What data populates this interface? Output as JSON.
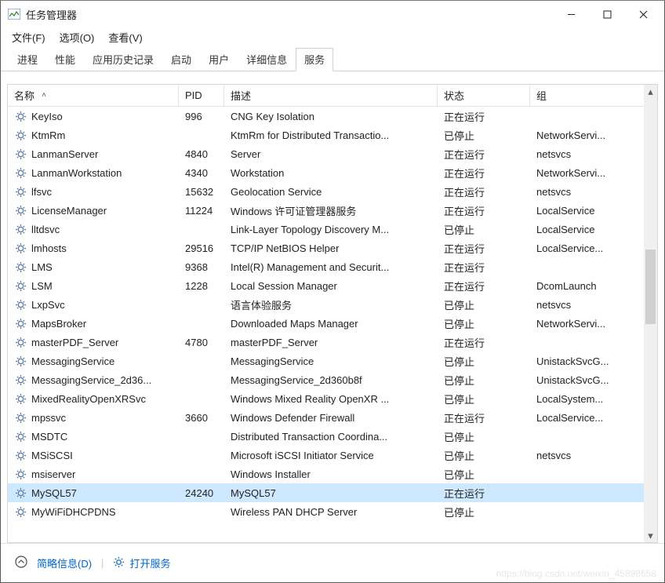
{
  "window": {
    "title": "任务管理器"
  },
  "menubar": [
    {
      "label": "文件(F)"
    },
    {
      "label": "选项(O)"
    },
    {
      "label": "查看(V)"
    }
  ],
  "tabs": [
    {
      "label": "进程",
      "active": false
    },
    {
      "label": "性能",
      "active": false
    },
    {
      "label": "应用历史记录",
      "active": false
    },
    {
      "label": "启动",
      "active": false
    },
    {
      "label": "用户",
      "active": false
    },
    {
      "label": "详细信息",
      "active": false
    },
    {
      "label": "服务",
      "active": true
    }
  ],
  "columns": {
    "name": "名称",
    "pid": "PID",
    "desc": "描述",
    "status": "状态",
    "group": "组"
  },
  "services": [
    {
      "name": "KeyIso",
      "pid": "996",
      "desc": "CNG Key Isolation",
      "status": "正在运行",
      "group": ""
    },
    {
      "name": "KtmRm",
      "pid": "",
      "desc": "KtmRm for Distributed Transactio...",
      "status": "已停止",
      "group": "NetworkServi..."
    },
    {
      "name": "LanmanServer",
      "pid": "4840",
      "desc": "Server",
      "status": "正在运行",
      "group": "netsvcs"
    },
    {
      "name": "LanmanWorkstation",
      "pid": "4340",
      "desc": "Workstation",
      "status": "正在运行",
      "group": "NetworkServi..."
    },
    {
      "name": "lfsvc",
      "pid": "15632",
      "desc": "Geolocation Service",
      "status": "正在运行",
      "group": "netsvcs"
    },
    {
      "name": "LicenseManager",
      "pid": "11224",
      "desc": "Windows 许可证管理器服务",
      "status": "正在运行",
      "group": "LocalService"
    },
    {
      "name": "lltdsvc",
      "pid": "",
      "desc": "Link-Layer Topology Discovery M...",
      "status": "已停止",
      "group": "LocalService"
    },
    {
      "name": "lmhosts",
      "pid": "29516",
      "desc": "TCP/IP NetBIOS Helper",
      "status": "正在运行",
      "group": "LocalService..."
    },
    {
      "name": "LMS",
      "pid": "9368",
      "desc": "Intel(R) Management and Securit...",
      "status": "正在运行",
      "group": ""
    },
    {
      "name": "LSM",
      "pid": "1228",
      "desc": "Local Session Manager",
      "status": "正在运行",
      "group": "DcomLaunch"
    },
    {
      "name": "LxpSvc",
      "pid": "",
      "desc": "语言体验服务",
      "status": "已停止",
      "group": "netsvcs"
    },
    {
      "name": "MapsBroker",
      "pid": "",
      "desc": "Downloaded Maps Manager",
      "status": "已停止",
      "group": "NetworkServi..."
    },
    {
      "name": "masterPDF_Server",
      "pid": "4780",
      "desc": "masterPDF_Server",
      "status": "正在运行",
      "group": ""
    },
    {
      "name": "MessagingService",
      "pid": "",
      "desc": "MessagingService",
      "status": "已停止",
      "group": "UnistackSvcG..."
    },
    {
      "name": "MessagingService_2d36...",
      "pid": "",
      "desc": "MessagingService_2d360b8f",
      "status": "已停止",
      "group": "UnistackSvcG..."
    },
    {
      "name": "MixedRealityOpenXRSvc",
      "pid": "",
      "desc": "Windows Mixed Reality OpenXR ...",
      "status": "已停止",
      "group": "LocalSystem..."
    },
    {
      "name": "mpssvc",
      "pid": "3660",
      "desc": "Windows Defender Firewall",
      "status": "正在运行",
      "group": "LocalService..."
    },
    {
      "name": "MSDTC",
      "pid": "",
      "desc": "Distributed Transaction Coordina...",
      "status": "已停止",
      "group": ""
    },
    {
      "name": "MSiSCSI",
      "pid": "",
      "desc": "Microsoft iSCSI Initiator Service",
      "status": "已停止",
      "group": "netsvcs"
    },
    {
      "name": "msiserver",
      "pid": "",
      "desc": "Windows Installer",
      "status": "已停止",
      "group": ""
    },
    {
      "name": "MySQL57",
      "pid": "24240",
      "desc": "MySQL57",
      "status": "正在运行",
      "group": "",
      "selected": true
    },
    {
      "name": "MyWiFiDHCPDNS",
      "pid": "",
      "desc": "Wireless PAN DHCP Server",
      "status": "已停止",
      "group": ""
    }
  ],
  "footer": {
    "brief": "简略信息(D)",
    "open_services": "打开服务"
  },
  "watermark": "https://blog.csdn.net/weixin_45898658"
}
